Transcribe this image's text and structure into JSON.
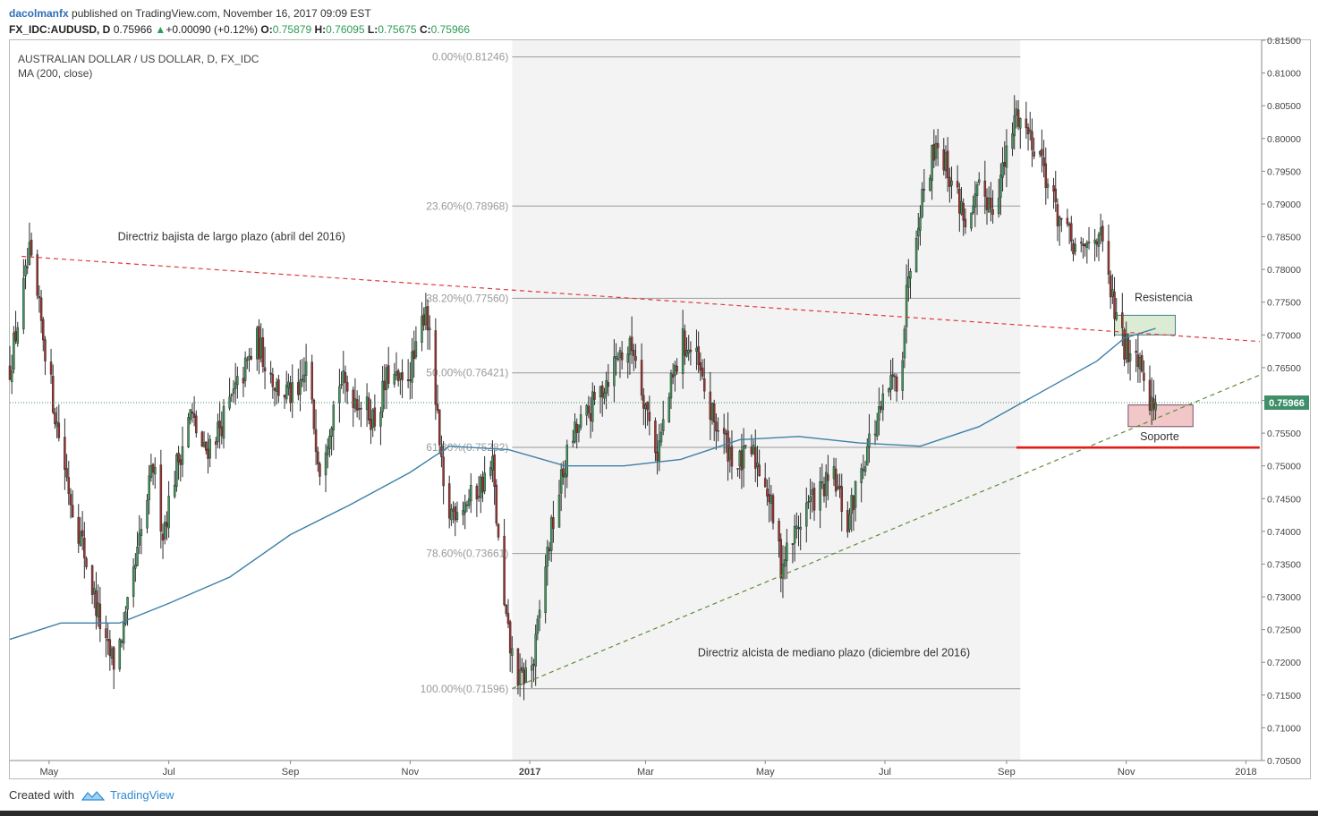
{
  "header": {
    "user": "dacolmanfx",
    "published": "published on TradingView.com, November 16, 2017 09:09 EST",
    "symbol": "FX_IDC:AUDUSD, D",
    "last": "0.75966",
    "change": "+0.00090 (+0.12%)",
    "open_label": "O:",
    "open": "0.75879",
    "high_label": "H:",
    "high": "0.76095",
    "low_label": "L:",
    "low": "0.75675",
    "close_label": "C:",
    "close": "0.75966"
  },
  "legend": {
    "title": "AUSTRALIAN DOLLAR / US DOLLAR, D, FX_IDC",
    "indicator": "MA (200, close)"
  },
  "footer": {
    "created_with": "Created with",
    "brand": "TradingView"
  },
  "colors": {
    "up": "#3f9a5b",
    "down": "#a3312f",
    "ma": "#3d7fa8",
    "downtrend": "#e03a3a",
    "uptrend": "#5e8c3a",
    "support_line": "#e21b1b",
    "fib": "#9a9a9a",
    "fib_box": "#f3f3f3",
    "resistance_box": "#dcebd3",
    "support_box": "#f2c7c7"
  },
  "chart_data": {
    "type": "candlestick",
    "title": "AUSTRALIAN DOLLAR / US DOLLAR, D, FX_IDC",
    "ylim": [
      0.705,
      0.815
    ],
    "y_ticks": [
      "0.81500",
      "0.81000",
      "0.80500",
      "0.80000",
      "0.79500",
      "0.79000",
      "0.78500",
      "0.78000",
      "0.77500",
      "0.77000",
      "0.76500",
      "0.76000",
      "0.75500",
      "0.75000",
      "0.74500",
      "0.74000",
      "0.73500",
      "0.73000",
      "0.72500",
      "0.72000",
      "0.71500",
      "0.71000",
      "0.70500"
    ],
    "x_ticks": [
      {
        "label": "May",
        "date": "2016-05-01"
      },
      {
        "label": "Jul",
        "date": "2016-07-01"
      },
      {
        "label": "Sep",
        "date": "2016-09-01"
      },
      {
        "label": "Nov",
        "date": "2016-11-01"
      },
      {
        "label": "2017",
        "date": "2017-01-01",
        "bold": true
      },
      {
        "label": "Mar",
        "date": "2017-03-01"
      },
      {
        "label": "May",
        "date": "2017-05-01"
      },
      {
        "label": "Jul",
        "date": "2017-07-01"
      },
      {
        "label": "Sep",
        "date": "2017-09-01"
      },
      {
        "label": "Nov",
        "date": "2017-11-01"
      },
      {
        "label": "2018",
        "date": "2018-01-01"
      }
    ],
    "x_range": [
      "2016-04-11",
      "2018-01-09"
    ],
    "last_price_label": "0.75966",
    "last_price": 0.75966,
    "close_path": [
      {
        "date": "2016-04-11",
        "close": 0.765
      },
      {
        "date": "2016-04-18",
        "close": 0.777
      },
      {
        "date": "2016-04-21",
        "close": 0.782
      },
      {
        "date": "2016-04-28",
        "close": 0.77
      },
      {
        "date": "2016-05-04",
        "close": 0.758
      },
      {
        "date": "2016-05-12",
        "close": 0.745
      },
      {
        "date": "2016-05-18",
        "close": 0.738
      },
      {
        "date": "2016-05-24",
        "close": 0.73
      },
      {
        "date": "2016-05-30",
        "close": 0.722
      },
      {
        "date": "2016-06-03",
        "close": 0.72
      },
      {
        "date": "2016-06-09",
        "close": 0.726
      },
      {
        "date": "2016-06-16",
        "close": 0.738
      },
      {
        "date": "2016-06-23",
        "close": 0.75
      },
      {
        "date": "2016-06-28",
        "close": 0.74
      },
      {
        "date": "2016-07-05",
        "close": 0.75
      },
      {
        "date": "2016-07-12",
        "close": 0.758
      },
      {
        "date": "2016-07-19",
        "close": 0.752
      },
      {
        "date": "2016-07-27",
        "close": 0.756
      },
      {
        "date": "2016-08-05",
        "close": 0.762
      },
      {
        "date": "2016-08-15",
        "close": 0.769
      },
      {
        "date": "2016-08-25",
        "close": 0.762
      },
      {
        "date": "2016-09-05",
        "close": 0.76
      },
      {
        "date": "2016-09-09",
        "close": 0.765
      },
      {
        "date": "2016-09-16",
        "close": 0.75
      },
      {
        "date": "2016-09-26",
        "close": 0.763
      },
      {
        "date": "2016-10-06",
        "close": 0.76
      },
      {
        "date": "2016-10-14",
        "close": 0.757
      },
      {
        "date": "2016-10-21",
        "close": 0.764
      },
      {
        "date": "2016-10-28",
        "close": 0.762
      },
      {
        "date": "2016-11-04",
        "close": 0.767
      },
      {
        "date": "2016-11-09",
        "close": 0.775
      },
      {
        "date": "2016-11-14",
        "close": 0.76
      },
      {
        "date": "2016-11-19",
        "close": 0.742
      },
      {
        "date": "2016-11-25",
        "close": 0.744
      },
      {
        "date": "2016-12-02",
        "close": 0.745
      },
      {
        "date": "2016-12-09",
        "close": 0.748
      },
      {
        "date": "2016-12-13",
        "close": 0.75
      },
      {
        "date": "2016-12-18",
        "close": 0.73
      },
      {
        "date": "2016-12-22",
        "close": 0.722
      },
      {
        "date": "2016-12-27",
        "close": 0.717
      },
      {
        "date": "2017-01-03",
        "close": 0.72
      },
      {
        "date": "2017-01-09",
        "close": 0.735
      },
      {
        "date": "2017-01-15",
        "close": 0.745
      },
      {
        "date": "2017-01-22",
        "close": 0.754
      },
      {
        "date": "2017-01-31",
        "close": 0.758
      },
      {
        "date": "2017-02-07",
        "close": 0.762
      },
      {
        "date": "2017-02-15",
        "close": 0.767
      },
      {
        "date": "2017-02-23",
        "close": 0.768
      },
      {
        "date": "2017-03-02",
        "close": 0.758
      },
      {
        "date": "2017-03-07",
        "close": 0.752
      },
      {
        "date": "2017-03-14",
        "close": 0.762
      },
      {
        "date": "2017-03-20",
        "close": 0.769
      },
      {
        "date": "2017-03-27",
        "close": 0.766
      },
      {
        "date": "2017-04-03",
        "close": 0.758
      },
      {
        "date": "2017-04-10",
        "close": 0.754
      },
      {
        "date": "2017-04-17",
        "close": 0.75
      },
      {
        "date": "2017-04-24",
        "close": 0.752
      },
      {
        "date": "2017-05-01",
        "close": 0.748
      },
      {
        "date": "2017-05-05",
        "close": 0.742
      },
      {
        "date": "2017-05-09",
        "close": 0.735
      },
      {
        "date": "2017-05-14",
        "close": 0.738
      },
      {
        "date": "2017-05-22",
        "close": 0.744
      },
      {
        "date": "2017-05-29",
        "close": 0.746
      },
      {
        "date": "2017-06-05",
        "close": 0.748
      },
      {
        "date": "2017-06-12",
        "close": 0.741
      },
      {
        "date": "2017-06-15",
        "close": 0.745
      },
      {
        "date": "2017-06-22",
        "close": 0.753
      },
      {
        "date": "2017-06-29",
        "close": 0.758
      },
      {
        "date": "2017-07-03",
        "close": 0.762
      },
      {
        "date": "2017-07-09",
        "close": 0.764
      },
      {
        "date": "2017-07-13",
        "close": 0.78
      },
      {
        "date": "2017-07-19",
        "close": 0.79
      },
      {
        "date": "2017-07-24",
        "close": 0.796
      },
      {
        "date": "2017-07-27",
        "close": 0.8
      },
      {
        "date": "2017-08-01",
        "close": 0.796
      },
      {
        "date": "2017-08-07",
        "close": 0.791
      },
      {
        "date": "2017-08-13",
        "close": 0.786
      },
      {
        "date": "2017-08-18",
        "close": 0.792
      },
      {
        "date": "2017-08-25",
        "close": 0.79
      },
      {
        "date": "2017-09-01",
        "close": 0.797
      },
      {
        "date": "2017-09-06",
        "close": 0.804
      },
      {
        "date": "2017-09-12",
        "close": 0.801
      },
      {
        "date": "2017-09-18",
        "close": 0.798
      },
      {
        "date": "2017-09-25",
        "close": 0.79
      },
      {
        "date": "2017-10-02",
        "close": 0.785
      },
      {
        "date": "2017-10-09",
        "close": 0.782
      },
      {
        "date": "2017-10-13",
        "close": 0.784
      },
      {
        "date": "2017-10-18",
        "close": 0.786
      },
      {
        "date": "2017-10-23",
        "close": 0.778
      },
      {
        "date": "2017-10-27",
        "close": 0.772
      },
      {
        "date": "2017-10-31",
        "close": 0.768
      },
      {
        "date": "2017-11-06",
        "close": 0.768
      },
      {
        "date": "2017-11-10",
        "close": 0.765
      },
      {
        "date": "2017-11-14",
        "close": 0.759
      },
      {
        "date": "2017-11-16",
        "close": 0.75966
      }
    ],
    "ma200_path": [
      {
        "date": "2016-04-11",
        "value": 0.7235
      },
      {
        "date": "2016-05-07",
        "value": 0.726
      },
      {
        "date": "2016-06-06",
        "value": 0.726
      },
      {
        "date": "2016-07-01",
        "value": 0.729
      },
      {
        "date": "2016-08-01",
        "value": 0.733
      },
      {
        "date": "2016-09-01",
        "value": 0.7395
      },
      {
        "date": "2016-10-01",
        "value": 0.744
      },
      {
        "date": "2016-11-01",
        "value": 0.749
      },
      {
        "date": "2016-11-21",
        "value": 0.753
      },
      {
        "date": "2016-12-21",
        "value": 0.7525
      },
      {
        "date": "2017-01-19",
        "value": 0.75
      },
      {
        "date": "2017-02-18",
        "value": 0.75
      },
      {
        "date": "2017-03-19",
        "value": 0.751
      },
      {
        "date": "2017-04-18",
        "value": 0.754
      },
      {
        "date": "2017-05-18",
        "value": 0.7545
      },
      {
        "date": "2017-06-18",
        "value": 0.7535
      },
      {
        "date": "2017-07-19",
        "value": 0.753
      },
      {
        "date": "2017-08-18",
        "value": 0.756
      },
      {
        "date": "2017-09-17",
        "value": 0.761
      },
      {
        "date": "2017-10-17",
        "value": 0.766
      },
      {
        "date": "2017-10-31",
        "value": 0.7695
      },
      {
        "date": "2017-11-16",
        "value": 0.771
      }
    ],
    "fibonacci": {
      "date_range": [
        "2016-12-23",
        "2017-09-08"
      ],
      "levels": [
        {
          "label": "0.00%(0.81246)",
          "value": 0.81246
        },
        {
          "label": "23.60%(0.78968)",
          "value": 0.78968
        },
        {
          "label": "38.20%(0.77560)",
          "value": 0.7756
        },
        {
          "label": "50.00%(0.76421)",
          "value": 0.76421
        },
        {
          "label": "61.80%(0.75282)",
          "value": 0.75282
        },
        {
          "label": "78.60%(0.73661)",
          "value": 0.73661
        },
        {
          "label": "100.00%(0.71596)",
          "value": 0.71596
        }
      ]
    },
    "trendlines": [
      {
        "name": "downtrend",
        "style": "dashed",
        "from": {
          "date": "2016-04-17",
          "value": 0.782
        },
        "to": {
          "date": "2018-01-08",
          "value": 0.769
        }
      },
      {
        "name": "uptrend",
        "style": "dashed",
        "from": {
          "date": "2016-12-23",
          "value": 0.716
        },
        "to": {
          "date": "2018-01-09",
          "value": 0.764
        }
      },
      {
        "name": "support",
        "style": "solid",
        "from": {
          "date": "2017-09-06",
          "value": 0.7528
        },
        "to": {
          "date": "2018-01-08",
          "value": 0.7528
        }
      }
    ],
    "zones": [
      {
        "name": "resistance-zone",
        "date_range": [
          "2017-10-26",
          "2017-11-26"
        ],
        "value_range": [
          0.77,
          0.773
        ]
      },
      {
        "name": "support-zone",
        "date_range": [
          "2017-11-02",
          "2017-12-05"
        ],
        "value_range": [
          0.756,
          0.7593
        ]
      }
    ],
    "annotations": [
      {
        "name": "downtrend-label",
        "text": "Directriz bajista de largo plazo (abril del 2016)",
        "date": "2016-08-02",
        "value": 0.785
      },
      {
        "name": "uptrend-label",
        "text": "Directriz alcista de mediano plazo (diciembre del 2016)",
        "date": "2017-06-05",
        "value": 0.7215
      },
      {
        "name": "resistance-label",
        "text": "Resistencia",
        "date": "2017-11-20",
        "value": 0.7757
      },
      {
        "name": "support-label",
        "text": "Soporte",
        "date": "2017-11-18",
        "value": 0.7545
      }
    ]
  }
}
